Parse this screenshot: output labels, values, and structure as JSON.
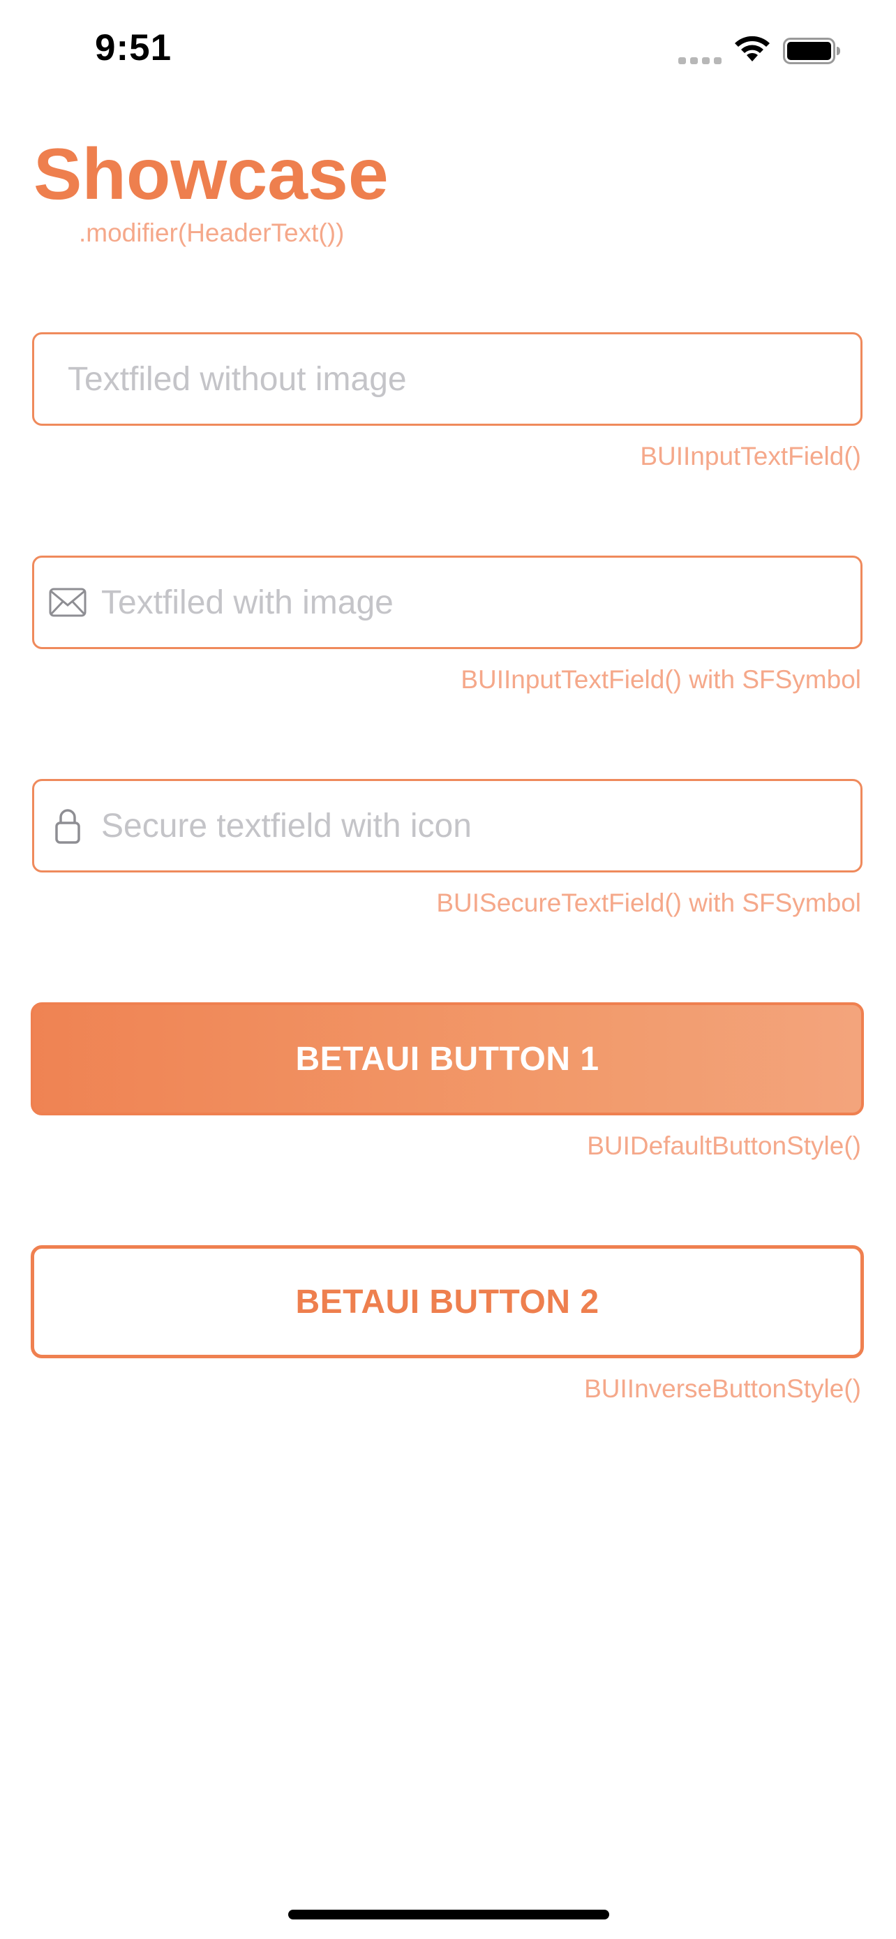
{
  "status_bar": {
    "time": "9:51",
    "icons": [
      "signal-icon",
      "wifi-icon",
      "battery-icon"
    ]
  },
  "header": {
    "title": "Showcase",
    "caption": ".modifier(HeaderText())"
  },
  "fields": [
    {
      "placeholder": "Textfiled without image",
      "caption": "BUIInputTextField()",
      "icon": null
    },
    {
      "placeholder": "Textfiled with image",
      "caption": "BUIInputTextField() with SFSymbol",
      "icon": "envelope-icon"
    },
    {
      "placeholder": "Secure textfield with icon",
      "caption": "BUISecureTextField() with SFSymbol",
      "icon": "lock-icon"
    }
  ],
  "buttons": [
    {
      "label": "BETAUI BUTTON 1",
      "caption": "BUIDefaultButtonStyle()"
    },
    {
      "label": "BETAUI BUTTON 2",
      "caption": "BUIInverseButtonStyle()"
    }
  ],
  "colors": {
    "accent": "#ee7f4e",
    "caption": "#f5a88a",
    "placeholder": "#c4c4c8",
    "border": "#ef8a5c"
  }
}
